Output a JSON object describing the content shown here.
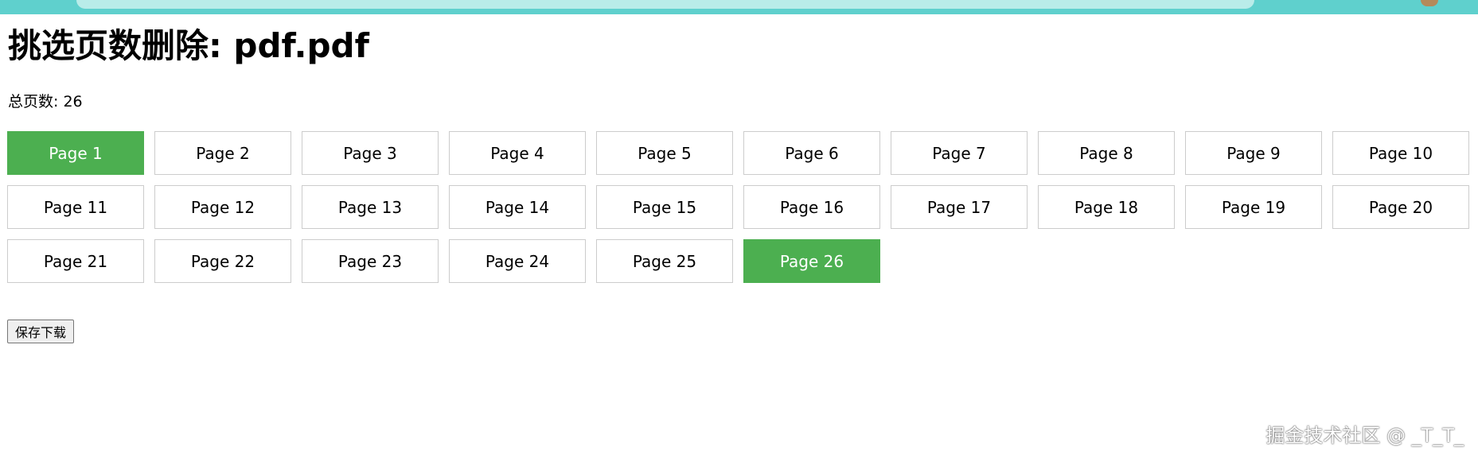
{
  "header": {
    "title": "挑选页数删除: pdf.pdf",
    "total_pages": "总页数: 26"
  },
  "pages": [
    {
      "label": "Page 1",
      "selected": true
    },
    {
      "label": "Page 2",
      "selected": false
    },
    {
      "label": "Page 3",
      "selected": false
    },
    {
      "label": "Page 4",
      "selected": false
    },
    {
      "label": "Page 5",
      "selected": false
    },
    {
      "label": "Page 6",
      "selected": false
    },
    {
      "label": "Page 7",
      "selected": false
    },
    {
      "label": "Page 8",
      "selected": false
    },
    {
      "label": "Page 9",
      "selected": false
    },
    {
      "label": "Page 10",
      "selected": false
    },
    {
      "label": "Page 11",
      "selected": false
    },
    {
      "label": "Page 12",
      "selected": false
    },
    {
      "label": "Page 13",
      "selected": false
    },
    {
      "label": "Page 14",
      "selected": false
    },
    {
      "label": "Page 15",
      "selected": false
    },
    {
      "label": "Page 16",
      "selected": false
    },
    {
      "label": "Page 17",
      "selected": false
    },
    {
      "label": "Page 18",
      "selected": false
    },
    {
      "label": "Page 19",
      "selected": false
    },
    {
      "label": "Page 20",
      "selected": false
    },
    {
      "label": "Page 21",
      "selected": false
    },
    {
      "label": "Page 22",
      "selected": false
    },
    {
      "label": "Page 23",
      "selected": false
    },
    {
      "label": "Page 24",
      "selected": false
    },
    {
      "label": "Page 25",
      "selected": false
    },
    {
      "label": "Page 26",
      "selected": true
    }
  ],
  "actions": {
    "save_label": "保存下载"
  },
  "watermark": "掘金技术社区 @ _T_T_",
  "colors": {
    "selected": "#4caf50",
    "browser_bar": "#5fd0cd"
  }
}
